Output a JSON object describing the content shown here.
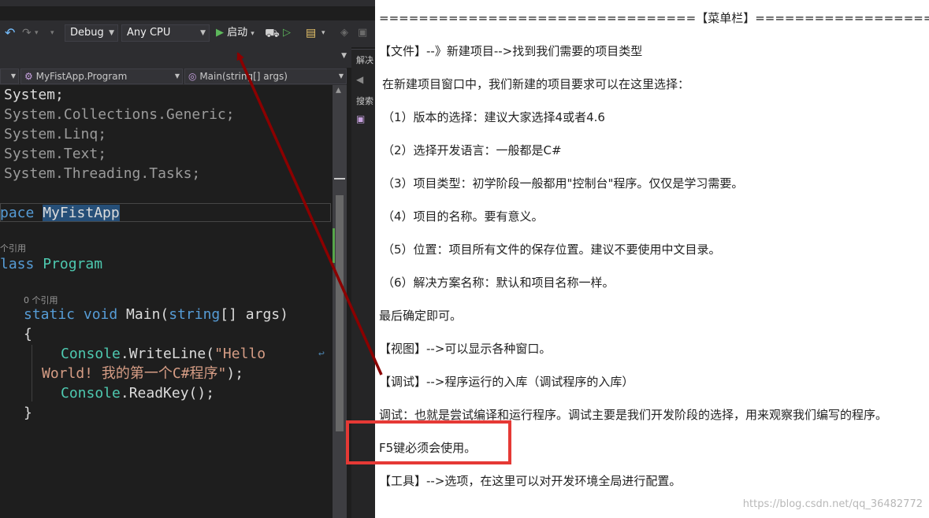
{
  "toolbar": {
    "config": "Debug",
    "platform": "Any CPU",
    "start_label": "启动"
  },
  "navbar": {
    "class_combo": "MyFistApp.Program",
    "member_combo": "Main(string[] args)"
  },
  "right_panel": {
    "tab_label": "解决",
    "search_label": "搜索"
  },
  "code": {
    "line1": "System;",
    "line2": "System.Collections.Generic;",
    "line3": "System.Linq;",
    "line4": "System.Text;",
    "line5": "System.Threading.Tasks;",
    "ns_keyword": "pace",
    "ns_name": "MyFistApp",
    "ref_count_1": "个引用",
    "class_keyword": "lass",
    "class_name": "Program",
    "ref_count_2": "0 个引用",
    "method_modifiers": "static void",
    "method_name": " Main(",
    "method_param_type": "string",
    "method_params_rest": "[] args)",
    "open_brace": "{",
    "console1": "Console",
    "writeline": ".WriteLine(",
    "hello_part1": "\"Hello",
    "hello_part2": "World! 我的第一个C#程序\"",
    "close_stmt": ");",
    "console2": "Console",
    "readkey": ".ReadKey();",
    "close_brace": "}"
  },
  "notes": {
    "header": "================================【菜单栏】=====================",
    "file_menu": "【文件】--》新建项目-->找到我们需要的项目类型",
    "intro": "在新建项目窗口中，我们新建的项目要求可以在这里选择：",
    "item1": "（1）版本的选择：建议大家选择4或者4.6",
    "item2": "（2）选择开发语言：一般都是C#",
    "item3": "（3）项目类型：初学阶段一般都用\"控制台\"程序。仅仅是学习需要。",
    "item4": "（4）项目的名称。要有意义。",
    "item5": "（5）位置：项目所有文件的保存位置。建议不要使用中文目录。",
    "item6": "（6）解决方案名称：默认和项目名称一样。",
    "confirm": "最后确定即可。",
    "view_menu": "【视图】-->可以显示各种窗口。",
    "debug_menu": "【调试】-->程序运行的入库（调试程序的入库）",
    "debug_desc": "调试：也就是尝试编译和运行程序。调试主要是我们开发阶段的选择，用来观察我们编写的程序。",
    "f5": "F5键必须会使用。",
    "tools_menu": "【工具】-->选项，在这里可以对开发环境全局进行配置。",
    "watermark": "https://blog.csdn.net/qq_36482772"
  },
  "colors": {
    "ide_bg": "#1e1e1e",
    "toolbar_bg": "#2d2d30",
    "keyword": "#569cd6",
    "type": "#4ec9b0",
    "string": "#d69d85",
    "arrow": "#8b0000",
    "highlight_box": "#e53935"
  }
}
